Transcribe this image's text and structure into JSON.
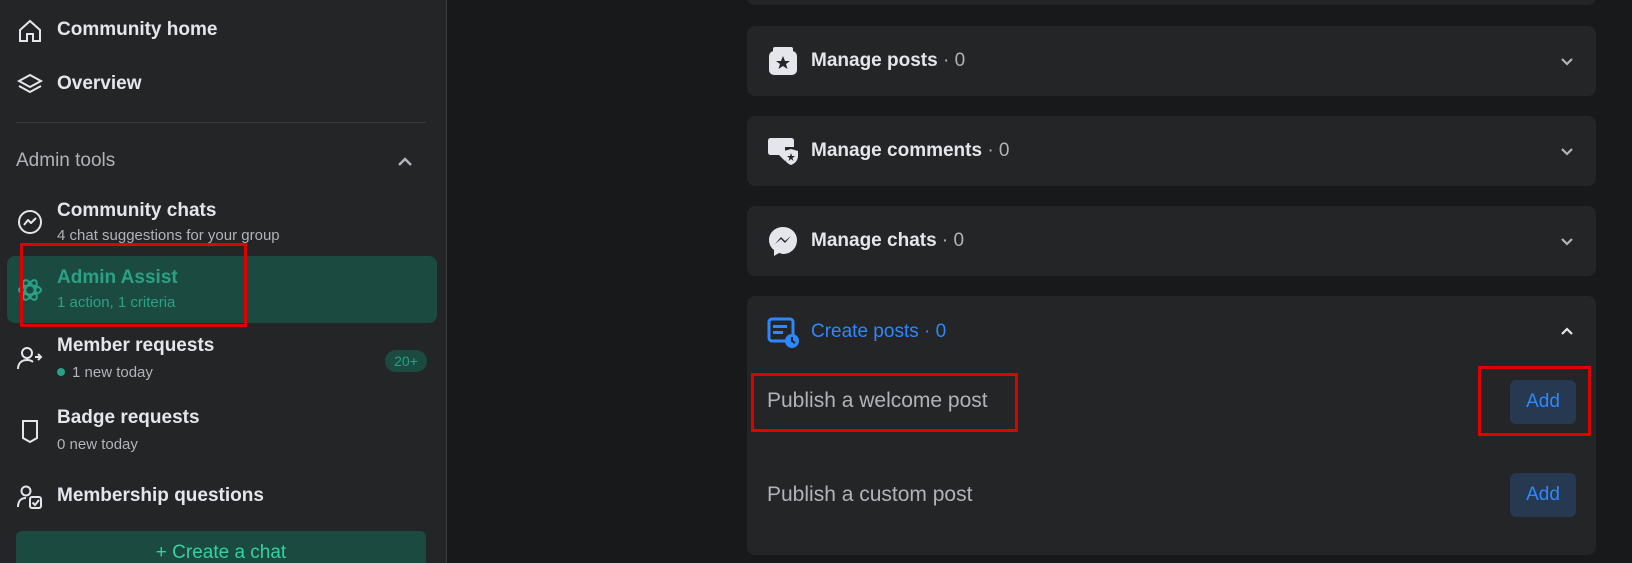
{
  "sidebar": {
    "items_top": [
      {
        "label": "Community home",
        "icon": "home-icon"
      },
      {
        "label": "Overview",
        "icon": "layers-icon"
      }
    ],
    "section_title": "Admin tools",
    "admin_items": [
      {
        "title": "Community chats",
        "subtitle": "4 chat suggestions for your group",
        "icon": "messenger-icon"
      },
      {
        "title": "Admin Assist",
        "subtitle": "1 action, 1 criteria",
        "icon": "atom-icon"
      },
      {
        "title": "Member requests",
        "subtitle": "1 new today",
        "badge": "20+",
        "icon": "person-arrow-icon"
      },
      {
        "title": "Badge requests",
        "subtitle": "0 new today",
        "icon": "badge-icon"
      },
      {
        "title": "Membership questions",
        "icon": "person-check-icon"
      }
    ],
    "create_chat_label": "+ Create a chat"
  },
  "main": {
    "cards": [
      {
        "title": "Manage posts",
        "count": " · 0",
        "icon": "post-star-icon"
      },
      {
        "title": "Manage comments",
        "count": " · 0",
        "icon": "comment-shield-icon"
      },
      {
        "title": "Manage chats",
        "count": " · 0",
        "icon": "messenger-icon"
      },
      {
        "title": "Create posts · 0",
        "icon": "post-clock-icon"
      }
    ],
    "create_posts_rows": [
      {
        "label": "Publish a welcome post",
        "action": "Add"
      },
      {
        "label": "Publish a custom post",
        "action": "Add"
      }
    ]
  },
  "colors": {
    "accent_green": "#35d1a5",
    "accent_blue": "#2d88ff",
    "highlight": "#e00000"
  }
}
